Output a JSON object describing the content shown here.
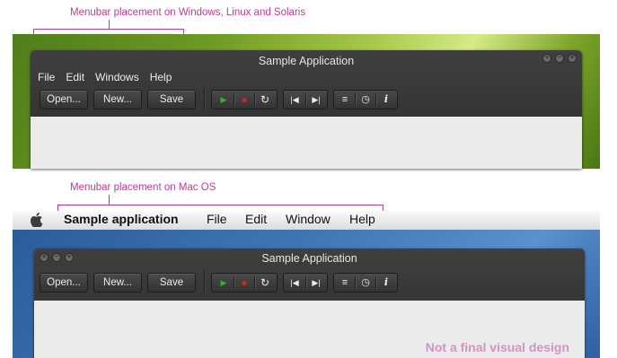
{
  "annotations": {
    "top": "Menubar placement on Windows, Linux and Solaris",
    "middle": "Menubar placement on Mac OS",
    "footnote": "Not a final visual design"
  },
  "app": {
    "title": "Sample Application",
    "menu": [
      "File",
      "Edit",
      "Windows",
      "Help"
    ],
    "buttons": {
      "open": "Open...",
      "new": "New...",
      "save": "Save"
    },
    "controls": {
      "play": "▶",
      "record": "●",
      "reload": "↻",
      "prev": "|◀",
      "next": "▶|",
      "list": "≡",
      "clock": "◷",
      "info": "i"
    },
    "window_controls": {
      "zoom": "+",
      "minimize": "−",
      "close": "×"
    }
  },
  "mac": {
    "apple_icon": "apple-logo",
    "app_name": "Sample application",
    "menu": [
      "File",
      "Edit",
      "Window",
      "Help"
    ]
  },
  "colors": {
    "annotation": "#c2398f",
    "play": "#2fb52f",
    "record": "#e0201b"
  }
}
